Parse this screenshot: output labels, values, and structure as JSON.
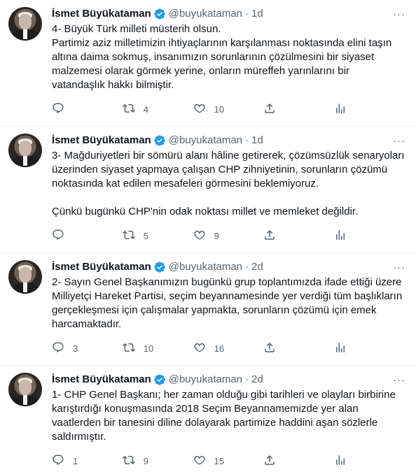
{
  "colors": {
    "text": "#0f1419",
    "secondary": "#536471",
    "verified": "#1d9bf0",
    "divider": "#eff3f4"
  },
  "tweets": [
    {
      "name": "İsmet Büyükataman",
      "handle": "@buyukataman",
      "time": "1d",
      "text": "4- Büyük Türk milleti müsterih olsun.\nPartimiz aziz milletimizin ihtiyaçlarının karşılanması noktasında elini taşın altına daima sokmuş, insanımızın sorunlarının çözülmesini bir siyaset malzemesi olarak görmek yerine, onların müreffeh yarınlarını bir vatandaşlık hakkı bilmiştir.",
      "replies": "",
      "retweets": "4",
      "likes": "10"
    },
    {
      "name": "İsmet Büyükataman",
      "handle": "@buyukataman",
      "time": "1d",
      "text": "3- Mağduriyetleri bir sömürü alanı hâline getirerek, çözümsüzlük senaryoları üzerinden siyaset yapmaya çalışan CHP zihniyetinin, sorunların çözümü noktasında kat edilen mesafeleri görmesini beklemiyoruz.\n\nÇünkü bugünkü CHP'nin odak noktası millet ve memleket değildir.",
      "replies": "",
      "retweets": "5",
      "likes": "9"
    },
    {
      "name": "İsmet Büyükataman",
      "handle": "@buyukataman",
      "time": "2d",
      "text": "2- Sayın Genel Başkanımızın bugünkü grup toplantımızda ifade ettiği üzere Milliyetçi Hareket Partisi, seçim beyannamesinde yer verdiği tüm başlıkların gerçekleşmesi için çalışmalar yapmakta, sorunların çözümü için emek harcamaktadır.",
      "replies": "3",
      "retweets": "10",
      "likes": "16"
    },
    {
      "name": "İsmet Büyükataman",
      "handle": "@buyukataman",
      "time": "2d",
      "text": "1- CHP Genel Başkanı; her zaman olduğu gibi tarihleri ve olayları birbirine karıştırdığı konuşmasında 2018 Seçim Beyannamemizde yer alan vaatlerden bir tanesini diline dolayarak partimize haddini aşan sözlerle saldırmıştır.",
      "replies": "1",
      "retweets": "9",
      "likes": "15"
    }
  ]
}
